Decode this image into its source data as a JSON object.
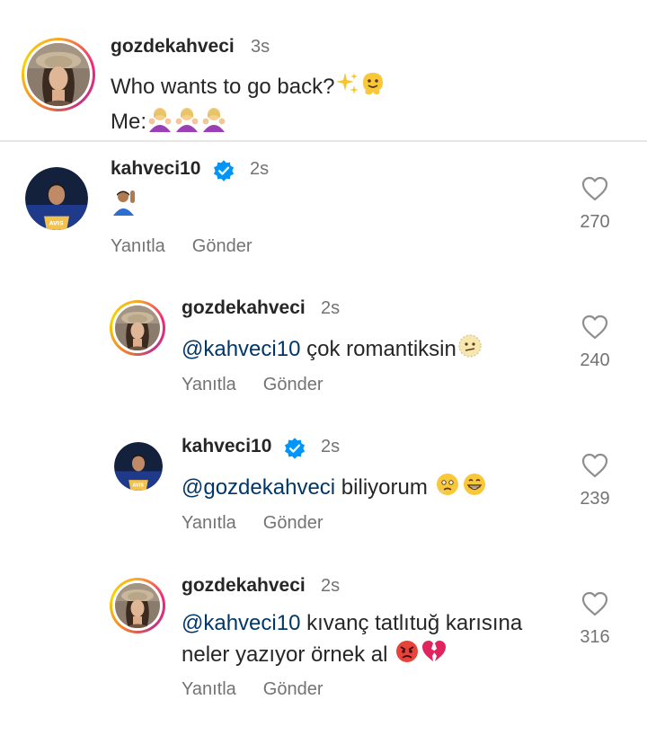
{
  "caption": {
    "username": "gozdekahveci",
    "time": "3s",
    "line1": "Who wants to go back?",
    "line2_prefix": "Me:"
  },
  "comments": [
    {
      "username": "kahveci10",
      "verified": true,
      "time": "2s",
      "text": "",
      "emoji": "raised-hand-emoji",
      "likes": "270",
      "reply_label": "Yanıtla",
      "send_label": "Gönder"
    },
    {
      "username": "gozdekahveci",
      "verified": false,
      "time": "2s",
      "mention": "@kahveci10",
      "text": " çok romantiksin",
      "likes": "240",
      "reply_label": "Yanıtla",
      "send_label": "Gönder"
    },
    {
      "username": "kahveci10",
      "verified": true,
      "time": "2s",
      "mention": "@gozdekahveci",
      "text": " biliyorum ",
      "likes": "239",
      "reply_label": "Yanıtla",
      "send_label": "Gönder"
    },
    {
      "username": "gozdekahveci",
      "verified": false,
      "time": "2s",
      "mention": "@kahveci10",
      "text": " kıvanç tatlıtuğ karısına",
      "text_line2": "neler yazıyor örnek al ",
      "likes": "316",
      "reply_label": "Yanıtla",
      "send_label": "Gönder"
    }
  ],
  "colors": {
    "mention": "#00376b",
    "verified": "#0095f6",
    "muted": "#737373"
  }
}
